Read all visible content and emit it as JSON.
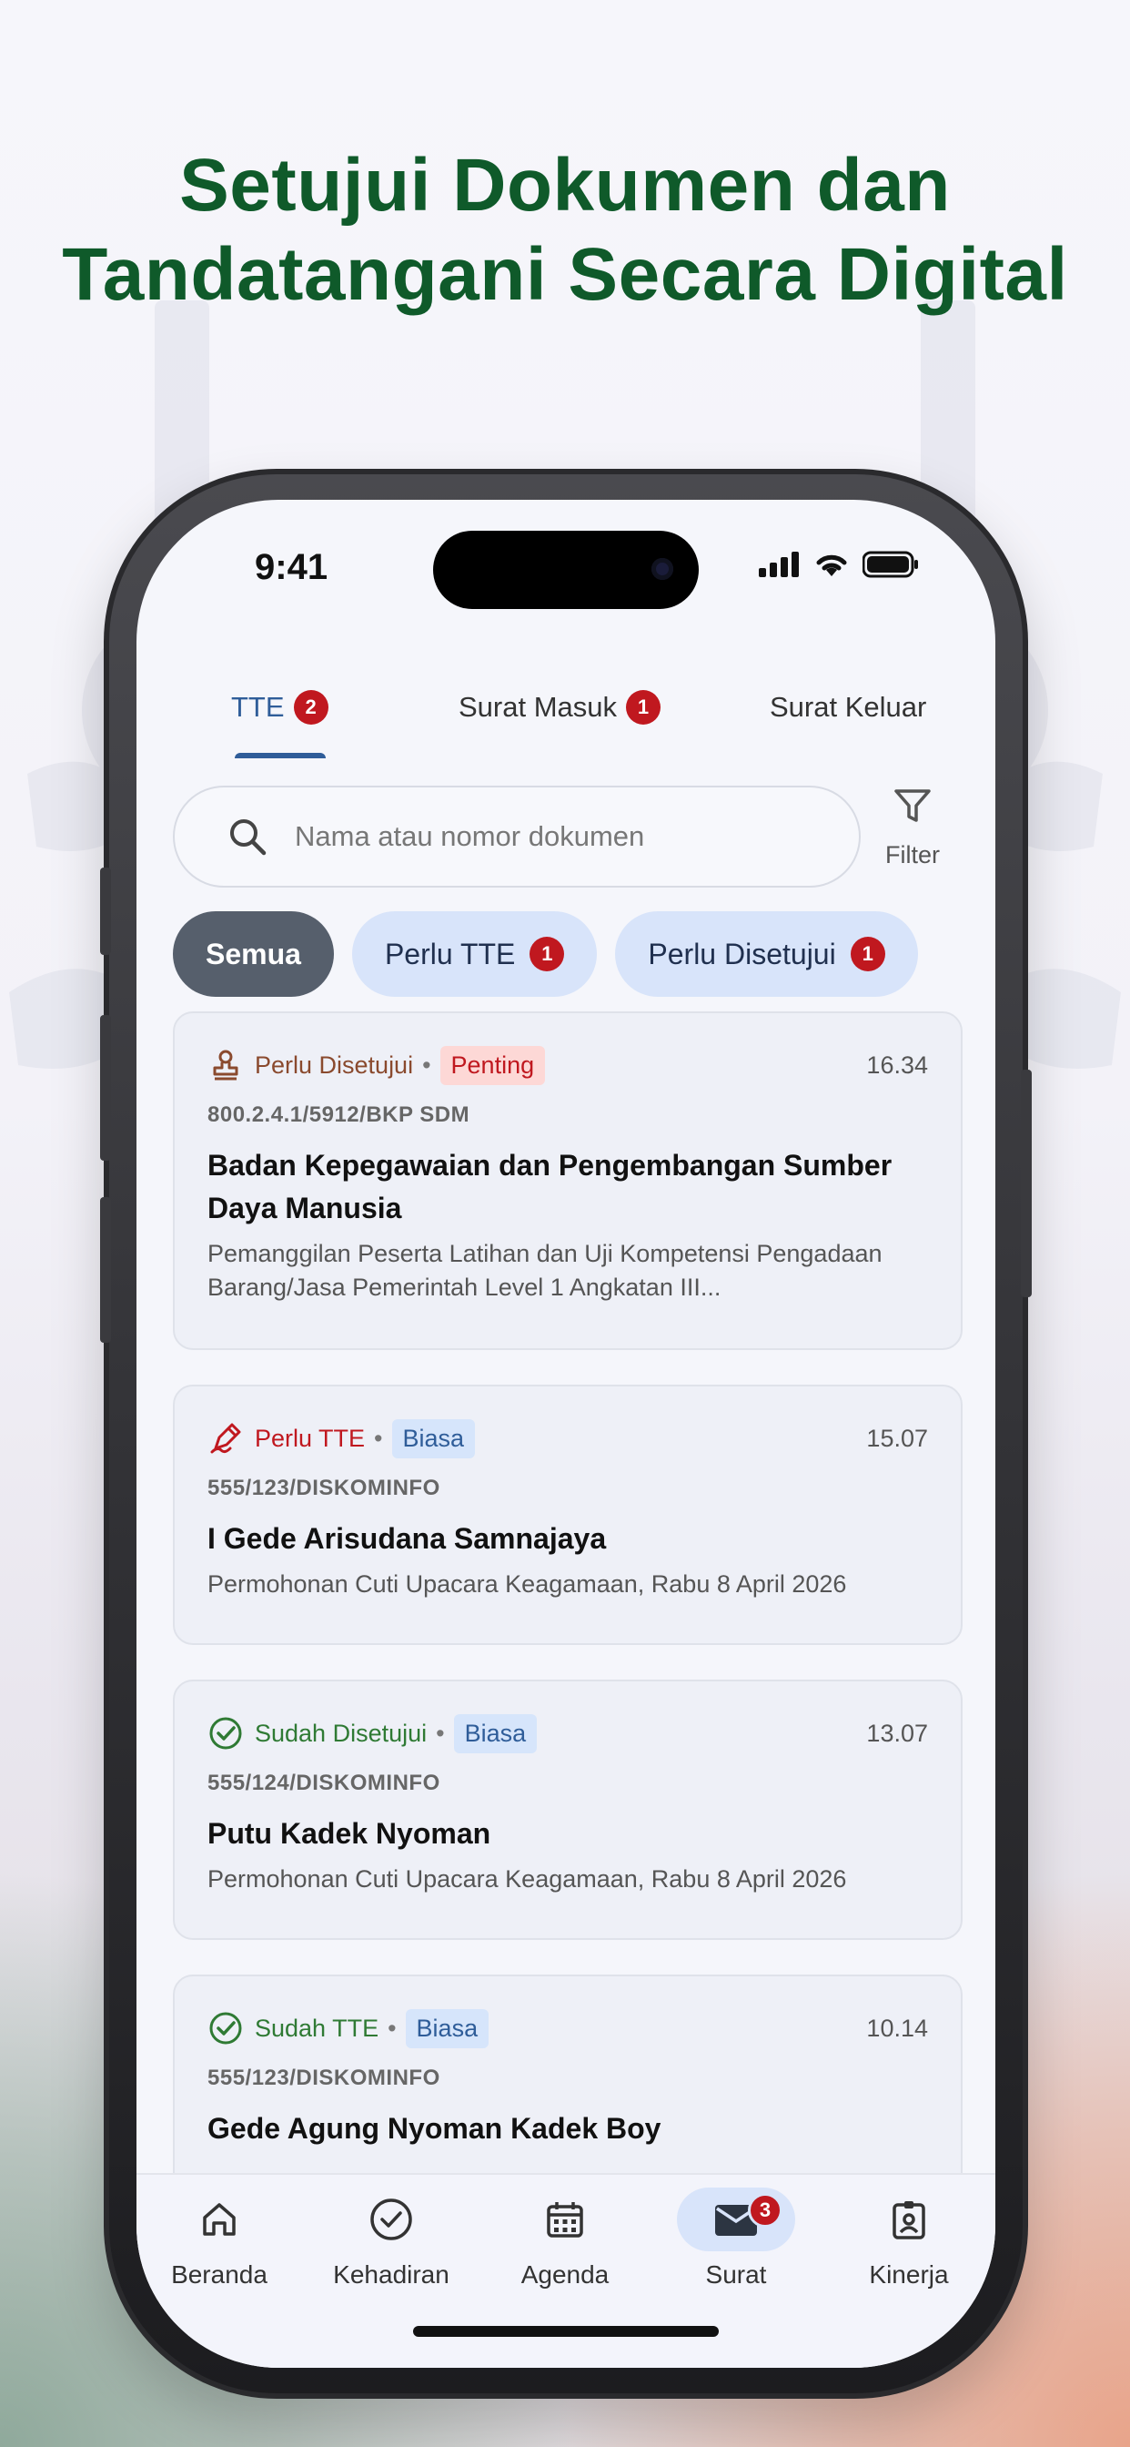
{
  "headline": {
    "line1": "Setujui Dokumen dan",
    "line2": "Tandatangani Secara Digital"
  },
  "status_bar": {
    "time": "9:41",
    "icons": [
      "signal-icon",
      "wifi-icon",
      "battery-icon"
    ]
  },
  "tabs": [
    {
      "label": "TTE",
      "badge": "2",
      "active": true
    },
    {
      "label": "Surat Masuk",
      "badge": "1",
      "active": false
    },
    {
      "label": "Surat Keluar",
      "badge": null,
      "active": false
    }
  ],
  "search": {
    "placeholder": "Nama atau nomor dokumen"
  },
  "filter": {
    "label": "Filter"
  },
  "chips": [
    {
      "label": "Semua",
      "badge": null,
      "active": true
    },
    {
      "label": "Perlu TTE",
      "badge": "1",
      "active": false
    },
    {
      "label": "Perlu Disetujui",
      "badge": "1",
      "active": false
    }
  ],
  "documents": [
    {
      "status": "Perlu Disetujui",
      "status_icon": "stamp-icon",
      "status_color": "#8a4a2e",
      "priority": "Penting",
      "time": "16.34",
      "number": "800.2.4.1/5912/BKP SDM",
      "title": "Badan Kepegawaian dan Pengembangan Sumber Daya Manusia",
      "description": "Pemanggilan Peserta Latihan dan Uji Kompetensi Pengadaan Barang/Jasa Pemerintah Level 1 Angkatan III..."
    },
    {
      "status": "Perlu TTE",
      "status_icon": "signature-icon",
      "status_color": "#c0181f",
      "priority": "Biasa",
      "time": "15.07",
      "number": "555/123/DISKOMINFO",
      "title": "I Gede Arisudana Samnajaya",
      "description": "Permohonan Cuti Upacara Keagamaan, Rabu 8 April 2026"
    },
    {
      "status": "Sudah Disetujui",
      "status_icon": "check-circle-icon",
      "status_color": "#2f7a34",
      "priority": "Biasa",
      "time": "13.07",
      "number": "555/124/DISKOMINFO",
      "title": "Putu Kadek Nyoman",
      "description": "Permohonan Cuti Upacara Keagamaan, Rabu 8 April 2026"
    },
    {
      "status": "Sudah TTE",
      "status_icon": "check-circle-icon",
      "status_color": "#2f7a34",
      "priority": "Biasa",
      "time": "10.14",
      "number": "555/123/DISKOMINFO",
      "title": "Gede Agung Nyoman Kadek Boy",
      "description": ""
    }
  ],
  "bottom_nav": [
    {
      "label": "Beranda",
      "icon": "home-icon",
      "active": false
    },
    {
      "label": "Kehadiran",
      "icon": "check-circle-icon",
      "active": false
    },
    {
      "label": "Agenda",
      "icon": "calendar-icon",
      "active": false
    },
    {
      "label": "Surat",
      "icon": "mail-icon",
      "active": true,
      "badge": "3"
    },
    {
      "label": "Kinerja",
      "icon": "badge-icon",
      "active": false
    }
  ],
  "colors": {
    "headline": "#0f5a2a",
    "accent": "#2f5d99",
    "badge": "#c0181f"
  }
}
